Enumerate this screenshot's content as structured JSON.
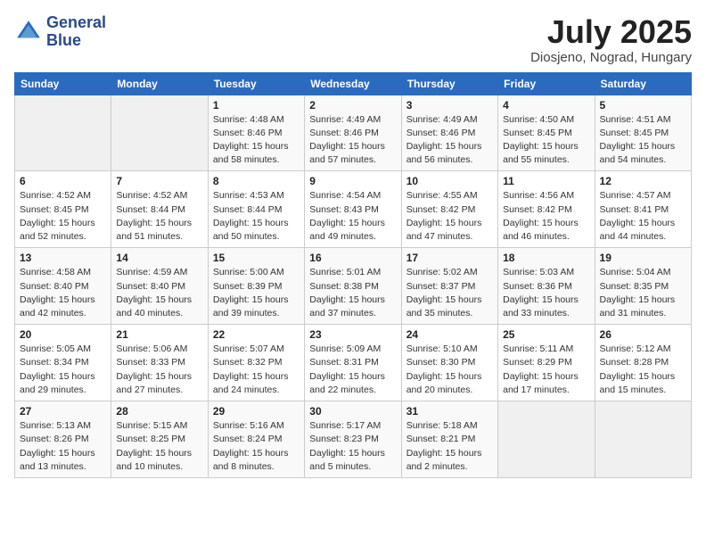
{
  "logo": {
    "line1": "General",
    "line2": "Blue"
  },
  "title": "July 2025",
  "location": "Diosjeno, Nograd, Hungary",
  "weekdays": [
    "Sunday",
    "Monday",
    "Tuesday",
    "Wednesday",
    "Thursday",
    "Friday",
    "Saturday"
  ],
  "weeks": [
    [
      {
        "day": "",
        "info": ""
      },
      {
        "day": "",
        "info": ""
      },
      {
        "day": "1",
        "info": "Sunrise: 4:48 AM\nSunset: 8:46 PM\nDaylight: 15 hours\nand 58 minutes."
      },
      {
        "day": "2",
        "info": "Sunrise: 4:49 AM\nSunset: 8:46 PM\nDaylight: 15 hours\nand 57 minutes."
      },
      {
        "day": "3",
        "info": "Sunrise: 4:49 AM\nSunset: 8:46 PM\nDaylight: 15 hours\nand 56 minutes."
      },
      {
        "day": "4",
        "info": "Sunrise: 4:50 AM\nSunset: 8:45 PM\nDaylight: 15 hours\nand 55 minutes."
      },
      {
        "day": "5",
        "info": "Sunrise: 4:51 AM\nSunset: 8:45 PM\nDaylight: 15 hours\nand 54 minutes."
      }
    ],
    [
      {
        "day": "6",
        "info": "Sunrise: 4:52 AM\nSunset: 8:45 PM\nDaylight: 15 hours\nand 52 minutes."
      },
      {
        "day": "7",
        "info": "Sunrise: 4:52 AM\nSunset: 8:44 PM\nDaylight: 15 hours\nand 51 minutes."
      },
      {
        "day": "8",
        "info": "Sunrise: 4:53 AM\nSunset: 8:44 PM\nDaylight: 15 hours\nand 50 minutes."
      },
      {
        "day": "9",
        "info": "Sunrise: 4:54 AM\nSunset: 8:43 PM\nDaylight: 15 hours\nand 49 minutes."
      },
      {
        "day": "10",
        "info": "Sunrise: 4:55 AM\nSunset: 8:42 PM\nDaylight: 15 hours\nand 47 minutes."
      },
      {
        "day": "11",
        "info": "Sunrise: 4:56 AM\nSunset: 8:42 PM\nDaylight: 15 hours\nand 46 minutes."
      },
      {
        "day": "12",
        "info": "Sunrise: 4:57 AM\nSunset: 8:41 PM\nDaylight: 15 hours\nand 44 minutes."
      }
    ],
    [
      {
        "day": "13",
        "info": "Sunrise: 4:58 AM\nSunset: 8:40 PM\nDaylight: 15 hours\nand 42 minutes."
      },
      {
        "day": "14",
        "info": "Sunrise: 4:59 AM\nSunset: 8:40 PM\nDaylight: 15 hours\nand 40 minutes."
      },
      {
        "day": "15",
        "info": "Sunrise: 5:00 AM\nSunset: 8:39 PM\nDaylight: 15 hours\nand 39 minutes."
      },
      {
        "day": "16",
        "info": "Sunrise: 5:01 AM\nSunset: 8:38 PM\nDaylight: 15 hours\nand 37 minutes."
      },
      {
        "day": "17",
        "info": "Sunrise: 5:02 AM\nSunset: 8:37 PM\nDaylight: 15 hours\nand 35 minutes."
      },
      {
        "day": "18",
        "info": "Sunrise: 5:03 AM\nSunset: 8:36 PM\nDaylight: 15 hours\nand 33 minutes."
      },
      {
        "day": "19",
        "info": "Sunrise: 5:04 AM\nSunset: 8:35 PM\nDaylight: 15 hours\nand 31 minutes."
      }
    ],
    [
      {
        "day": "20",
        "info": "Sunrise: 5:05 AM\nSunset: 8:34 PM\nDaylight: 15 hours\nand 29 minutes."
      },
      {
        "day": "21",
        "info": "Sunrise: 5:06 AM\nSunset: 8:33 PM\nDaylight: 15 hours\nand 27 minutes."
      },
      {
        "day": "22",
        "info": "Sunrise: 5:07 AM\nSunset: 8:32 PM\nDaylight: 15 hours\nand 24 minutes."
      },
      {
        "day": "23",
        "info": "Sunrise: 5:09 AM\nSunset: 8:31 PM\nDaylight: 15 hours\nand 22 minutes."
      },
      {
        "day": "24",
        "info": "Sunrise: 5:10 AM\nSunset: 8:30 PM\nDaylight: 15 hours\nand 20 minutes."
      },
      {
        "day": "25",
        "info": "Sunrise: 5:11 AM\nSunset: 8:29 PM\nDaylight: 15 hours\nand 17 minutes."
      },
      {
        "day": "26",
        "info": "Sunrise: 5:12 AM\nSunset: 8:28 PM\nDaylight: 15 hours\nand 15 minutes."
      }
    ],
    [
      {
        "day": "27",
        "info": "Sunrise: 5:13 AM\nSunset: 8:26 PM\nDaylight: 15 hours\nand 13 minutes."
      },
      {
        "day": "28",
        "info": "Sunrise: 5:15 AM\nSunset: 8:25 PM\nDaylight: 15 hours\nand 10 minutes."
      },
      {
        "day": "29",
        "info": "Sunrise: 5:16 AM\nSunset: 8:24 PM\nDaylight: 15 hours\nand 8 minutes."
      },
      {
        "day": "30",
        "info": "Sunrise: 5:17 AM\nSunset: 8:23 PM\nDaylight: 15 hours\nand 5 minutes."
      },
      {
        "day": "31",
        "info": "Sunrise: 5:18 AM\nSunset: 8:21 PM\nDaylight: 15 hours\nand 2 minutes."
      },
      {
        "day": "",
        "info": ""
      },
      {
        "day": "",
        "info": ""
      }
    ]
  ]
}
